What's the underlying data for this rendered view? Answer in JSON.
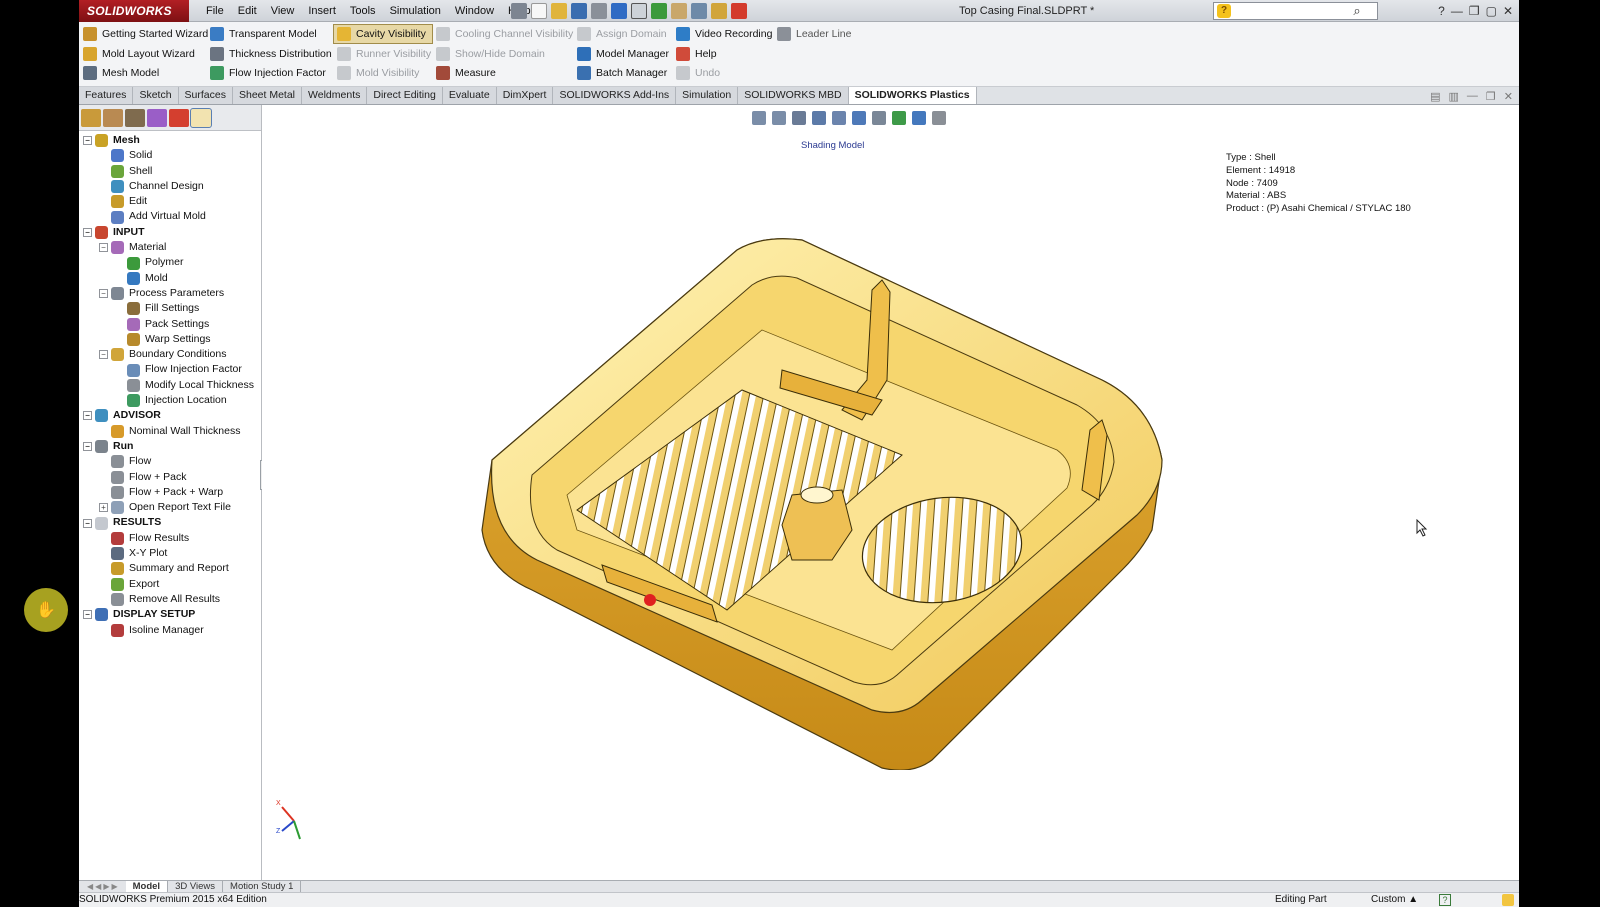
{
  "window": {
    "app_name": "SOLIDWORKS",
    "doc_title": "Top Casing Final.SLDPRT *",
    "menus": [
      "File",
      "Edit",
      "View",
      "Insert",
      "Tools",
      "Simulation",
      "Window",
      "Help"
    ]
  },
  "command_manager": {
    "col1": [
      "Getting Started Wizard",
      "Mold Layout Wizard",
      "Mesh Model"
    ],
    "col2": [
      "Transparent Model",
      "Thickness Distribution",
      "Flow Injection Factor"
    ],
    "col3": [
      "Cavity Visibility",
      "Runner Visibility",
      "Mold Visibility"
    ],
    "col4": [
      "Cooling Channel Visibility",
      "Show/Hide Domain",
      "Measure"
    ],
    "col5": [
      "Assign Domain",
      "Model Manager",
      "Batch Manager"
    ],
    "col6": [
      "Video Recording",
      "Help",
      "Undo"
    ],
    "col7": [
      "Leader Line"
    ]
  },
  "tabs": [
    "Features",
    "Sketch",
    "Surfaces",
    "Sheet Metal",
    "Weldments",
    "Direct Editing",
    "Evaluate",
    "DimXpert",
    "SOLIDWORKS Add-Ins",
    "Simulation",
    "SOLIDWORKS MBD",
    "SOLIDWORKS Plastics"
  ],
  "tree": [
    {
      "label": "Mesh",
      "level": 0,
      "top": true,
      "color": "#c9a225",
      "expander": "−"
    },
    {
      "label": "Solid",
      "level": 1,
      "color": "#4d77c9"
    },
    {
      "label": "Shell",
      "level": 1,
      "color": "#6aa53a"
    },
    {
      "label": "Channel Design",
      "level": 1,
      "color": "#3f8fbf"
    },
    {
      "label": "Edit",
      "level": 1,
      "color": "#c79b2a"
    },
    {
      "label": "Add Virtual Mold",
      "level": 1,
      "color": "#5c7ec2"
    },
    {
      "label": "INPUT",
      "level": 0,
      "top": true,
      "color": "#c8462f",
      "expander": "−"
    },
    {
      "label": "Material",
      "level": 1,
      "color": "#a56ab8",
      "expander": "−"
    },
    {
      "label": "Polymer",
      "level": 2,
      "color": "#3c9a3c"
    },
    {
      "label": "Mold",
      "level": 2,
      "color": "#3579c0"
    },
    {
      "label": "Process Parameters",
      "level": 1,
      "color": "#7e8793",
      "expander": "−"
    },
    {
      "label": "Fill Settings",
      "level": 2,
      "color": "#8a6d3b"
    },
    {
      "label": "Pack Settings",
      "level": 2,
      "color": "#a56ab8"
    },
    {
      "label": "Warp Settings",
      "level": 2,
      "color": "#b78a2c"
    },
    {
      "label": "Boundary Conditions",
      "level": 1,
      "color": "#d0a53a",
      "expander": "−"
    },
    {
      "label": "Flow Injection Factor",
      "level": 2,
      "color": "#6a8db8"
    },
    {
      "label": "Modify Local Thickness",
      "level": 2,
      "color": "#8a8f96"
    },
    {
      "label": "Injection Location",
      "level": 2,
      "color": "#3d9a60"
    },
    {
      "label": "ADVISOR",
      "level": 0,
      "top": true,
      "color": "#3f8fbf",
      "expander": "−"
    },
    {
      "label": "Nominal Wall Thickness",
      "level": 1,
      "color": "#d79a2a"
    },
    {
      "label": "Run",
      "level": 0,
      "top": true,
      "color": "#7b838c",
      "expander": "−"
    },
    {
      "label": "Flow",
      "level": 1,
      "color": "#8a8f96"
    },
    {
      "label": "Flow + Pack",
      "level": 1,
      "color": "#8a8f96"
    },
    {
      "label": "Flow + Pack + Warp",
      "level": 1,
      "color": "#8a8f96"
    },
    {
      "label": "Open Report Text File",
      "level": 1,
      "color": "#8ea0b7",
      "expander": "+"
    },
    {
      "label": "RESULTS",
      "level": 0,
      "top": true,
      "color": "#c4c8cf",
      "expander": "−"
    },
    {
      "label": "Flow Results",
      "level": 1,
      "color": "#b33c3c"
    },
    {
      "label": "X-Y Plot",
      "level": 1,
      "color": "#5c6b80"
    },
    {
      "label": "Summary and Report",
      "level": 1,
      "color": "#c79b2a"
    },
    {
      "label": "Export",
      "level": 1,
      "color": "#6aa53a"
    },
    {
      "label": "Remove All Results",
      "level": 1,
      "color": "#8a8f96"
    },
    {
      "label": "DISPLAY SETUP",
      "level": 0,
      "top": true,
      "color": "#3f6fb5",
      "expander": "−"
    },
    {
      "label": "Isoline Manager",
      "level": 1,
      "color": "#b33c3c"
    }
  ],
  "graphics": {
    "shading_label": "Shading Model",
    "info": {
      "type": "Type : Shell",
      "element": "Element : 14918",
      "node": "Node : 7409",
      "material": "Material : ABS",
      "product": "Product :  (P)  Asahi Chemical / STYLAC 180"
    },
    "triad_x": "X",
    "triad_z": "Z"
  },
  "bottom_tabs": [
    "Model",
    "3D Views",
    "Motion Study 1"
  ],
  "status": {
    "edition": "SOLIDWORKS Premium 2015 x64 Edition",
    "editing": "Editing Part",
    "units": "Custom",
    "units_arrow": "▲",
    "help_glyph": "?"
  },
  "colors": {
    "model_fill": "#f5d56a",
    "model_dark": "#c98f1c",
    "accent_red": "#e02020"
  }
}
